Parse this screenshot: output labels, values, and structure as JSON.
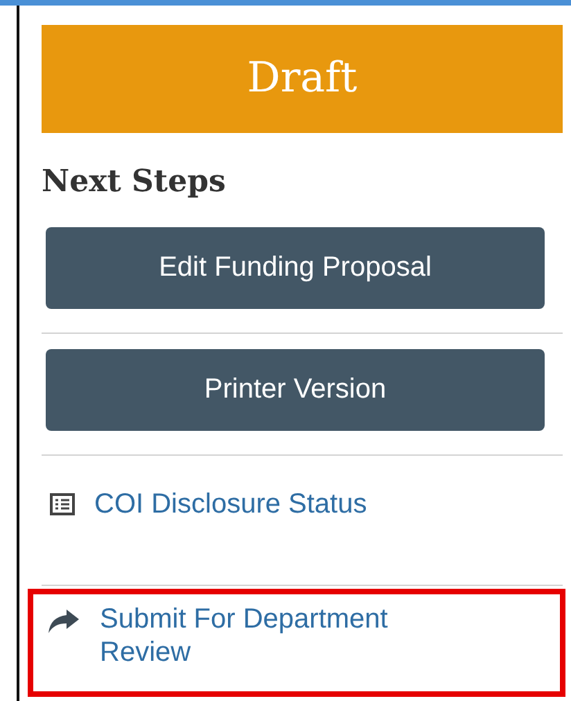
{
  "status": {
    "label": "Draft"
  },
  "next_steps": {
    "title": "Next Steps",
    "actions": [
      {
        "kind": "button",
        "label": "Edit Funding Proposal"
      },
      {
        "kind": "button",
        "label": "Printer Version"
      },
      {
        "kind": "list_link",
        "label": "COI Disclosure Status",
        "highlighted": false
      },
      {
        "kind": "forward_link",
        "label": "Submit For Department Review",
        "highlighted": true
      }
    ]
  }
}
